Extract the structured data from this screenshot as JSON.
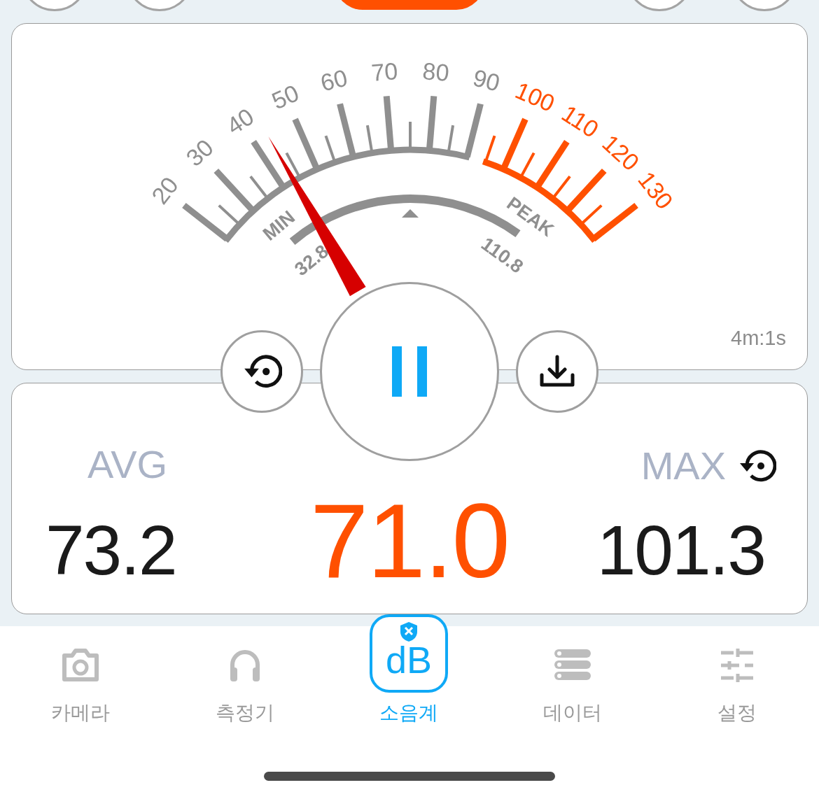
{
  "top_controls": [
    {
      "kind": "round"
    },
    {
      "kind": "round"
    },
    {
      "kind": "pill"
    },
    {
      "kind": "round"
    },
    {
      "kind": "round"
    }
  ],
  "gauge": {
    "scale": [
      {
        "label": "20",
        "color": "#8f8f8f"
      },
      {
        "label": "30",
        "color": "#8f8f8f"
      },
      {
        "label": "40",
        "color": "#8f8f8f"
      },
      {
        "label": "50",
        "color": "#8f8f8f"
      },
      {
        "label": "60",
        "color": "#8f8f8f"
      },
      {
        "label": "70",
        "color": "#8f8f8f"
      },
      {
        "label": "80",
        "color": "#8f8f8f"
      },
      {
        "label": "90",
        "color": "#8f8f8f"
      },
      {
        "label": "100",
        "color": "#ff5000"
      },
      {
        "label": "110",
        "color": "#ff5000"
      },
      {
        "label": "120",
        "color": "#ff5000"
      },
      {
        "label": "130",
        "color": "#ff5000"
      }
    ],
    "range": {
      "min_label": "MIN",
      "min_value": "32.8",
      "peak_label": "PEAK",
      "peak_value": "110.8"
    },
    "elapsed": "4m:1s"
  },
  "readings": {
    "avg_label": "AVG",
    "avg": "73.2",
    "current": "71.0",
    "max_label": "MAX",
    "max": "101.3"
  },
  "nav": [
    {
      "label": "카메라",
      "kind": "camera",
      "selected": false
    },
    {
      "label": "측정기",
      "kind": "headphones",
      "selected": false
    },
    {
      "label": "소음계",
      "kind": "logo",
      "logo_text": "dB",
      "selected": true
    },
    {
      "label": "데이터",
      "kind": "list",
      "selected": false
    },
    {
      "label": "설정",
      "kind": "sliders",
      "selected": false
    }
  ]
}
